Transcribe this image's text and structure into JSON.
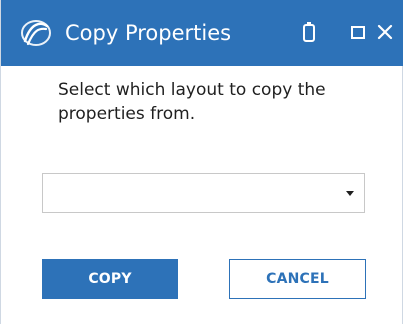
{
  "window": {
    "title": "Copy Properties",
    "app_icon": "swirl-logo-icon",
    "controls": [
      "battery-icon",
      "restore-icon",
      "close-icon"
    ]
  },
  "content": {
    "instruction": "Select which layout to copy the properties from.",
    "layout_select": {
      "value": "",
      "arrow_icon": "dropdown-arrow-icon"
    }
  },
  "buttons": {
    "copy_label": "COPY",
    "cancel_label": "CANCEL"
  },
  "colors": {
    "accent": "#2d72b8",
    "background": "#ffffff",
    "text": "#1f1f1f"
  }
}
